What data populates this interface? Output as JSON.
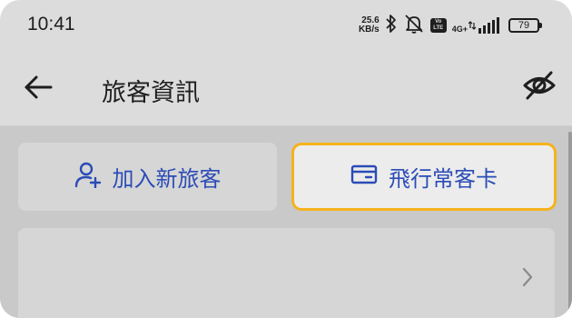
{
  "status_bar": {
    "time": "10:41",
    "net_speed_value": "25.6",
    "net_speed_unit": "KB/s",
    "volte_top": "Vo",
    "volte_bottom": "LTE",
    "network": "4G+",
    "battery": "79",
    "icons": [
      "bluetooth-icon",
      "mute-icon",
      "volte-icon",
      "signal-icon",
      "battery-icon"
    ]
  },
  "header": {
    "title": "旅客資訊",
    "back_icon": "arrow-left-icon",
    "hide_icon": "eye-off-icon"
  },
  "actions": {
    "add_traveler": {
      "label": "加入新旅客",
      "icon": "person-add-icon"
    },
    "frequent_flyer": {
      "label": "飛行常客卡",
      "icon": "card-icon"
    }
  },
  "list": {
    "chevron_icon": "chevron-right-icon"
  },
  "colors": {
    "accent_blue": "#2b4cb6",
    "highlight_border": "#f5b31c",
    "overlay_background": "#c9c9c9"
  }
}
